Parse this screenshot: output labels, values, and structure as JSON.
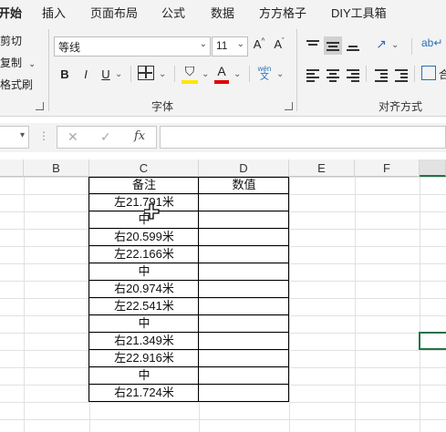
{
  "tabs": [
    "开始",
    "插入",
    "页面布局",
    "公式",
    "数据",
    "方方格子",
    "DIY工具箱"
  ],
  "clipboard": {
    "cut": "剪切",
    "copy": "复制",
    "format_painter": "格式刷"
  },
  "font": {
    "name": "等线",
    "size": "11",
    "grow": "A^",
    "shrink": "Aˇ",
    "bold": "B",
    "italic": "I",
    "underline": "U",
    "phonetic": "wén文",
    "group_label": "字体",
    "highlight_color": "#ffe600",
    "font_color": "#e00000"
  },
  "alignment": {
    "group_label": "对齐方式"
  },
  "formula_bar": {
    "cancel": "✕",
    "enter": "✓",
    "fx": "fx",
    "more": "⋮"
  },
  "columns": [
    "B",
    "C",
    "D",
    "E",
    "F"
  ],
  "table": {
    "header": [
      "备注",
      "数值"
    ],
    "rows": [
      [
        "左21.791米",
        ""
      ],
      [
        "中",
        ""
      ],
      [
        "右20.599米",
        ""
      ],
      [
        "左22.166米",
        ""
      ],
      [
        "中",
        ""
      ],
      [
        "右20.974米",
        ""
      ],
      [
        "左22.541米",
        ""
      ],
      [
        "中",
        ""
      ],
      [
        "右21.349米",
        ""
      ],
      [
        "左22.916米",
        ""
      ],
      [
        "中",
        ""
      ],
      [
        "右21.724米",
        ""
      ]
    ]
  }
}
